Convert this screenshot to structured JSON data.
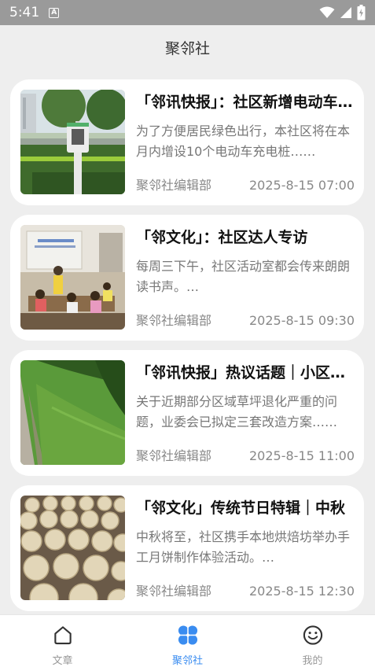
{
  "status_bar": {
    "time": "5:41",
    "badge": "A"
  },
  "header": {
    "title": "聚邻社"
  },
  "articles": [
    {
      "title": "「邻讯快报」：社区新增电动车充电桩",
      "excerpt": "为了方便居民绿色出行，本社区将在本月内增设10个电动车充电桩……",
      "author": "聚邻社编辑部",
      "time": "2025-8-15 07:00",
      "image": "charging-station-photo"
    },
    {
      "title": "「邻文化」：社区达人专访",
      "excerpt": "每周三下午，社区活动室都会传来朗朗读书声。…",
      "author": "聚邻社编辑部",
      "time": "2025-8-15 09:30",
      "image": "reading-room-photo"
    },
    {
      "title": "「邻讯快报」热议话题｜小区草坪",
      "excerpt": "关于近期部分区域草坪退化严重的问题，业委会已拟定三套改造方案……",
      "author": "聚邻社编辑部",
      "time": "2025-8-15 11:00",
      "image": "lawn-photo"
    },
    {
      "title": "「邻文化」传统节日特辑｜中秋",
      "excerpt": "中秋将至，社区携手本地烘焙坊举办手工月饼制作体验活动。…",
      "author": "聚邻社编辑部",
      "time": "2025-8-15 12:30",
      "image": "mooncake-photo"
    }
  ],
  "nav": [
    {
      "label": "文章",
      "icon": "home-icon",
      "active": false
    },
    {
      "label": "聚邻社",
      "icon": "grid-icon",
      "active": true
    },
    {
      "label": "我的",
      "icon": "smile-icon",
      "active": false
    }
  ],
  "colors": {
    "accent": "#3a8cf0",
    "status_bar": "#9a9a9a",
    "background": "#eeeeee"
  }
}
